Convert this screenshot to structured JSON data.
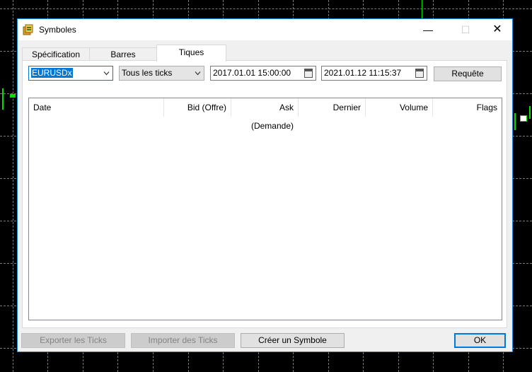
{
  "window": {
    "title": "Symboles",
    "icon": "symbols-app-icon"
  },
  "tabs": [
    {
      "label": "Spécification",
      "active": false
    },
    {
      "label": "Barres",
      "active": false
    },
    {
      "label": "Tiques",
      "active": true
    }
  ],
  "filters": {
    "symbol": "EURUSDx",
    "tick_type": "Tous les ticks",
    "date_from": "2017.01.01 15:00:00",
    "date_to": "2021.01.12 11:15:37",
    "request_label": "Requête"
  },
  "table": {
    "columns": [
      "Date",
      "Bid (Offre)",
      "Ask (Demande)",
      "Dernier",
      "Volume",
      "Flags"
    ],
    "rows": []
  },
  "buttons": {
    "export": "Exporter les Ticks",
    "import": "Importer des Ticks",
    "create": "Créer un Symbole",
    "ok": "OK"
  },
  "colors": {
    "accent": "#0078d7",
    "chart_background": "#000000",
    "candle": "#00e000"
  }
}
